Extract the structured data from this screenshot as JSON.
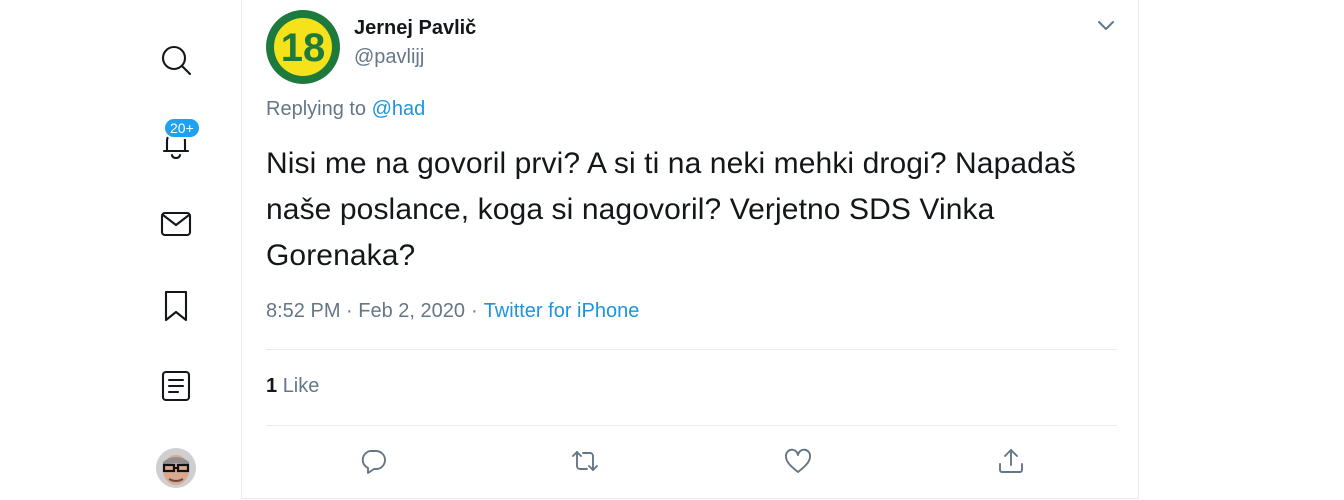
{
  "sidebar": {
    "notification_badge": "20+",
    "icons": [
      "search-icon",
      "bell-icon",
      "mail-icon",
      "bookmark-icon",
      "lists-icon",
      "profile-avatar"
    ]
  },
  "tweet": {
    "author": {
      "name": "Jernej Pavlič",
      "handle": "@pavlijj",
      "avatar_text": "18",
      "avatar_colors": {
        "background": "#1e7a3c",
        "circle": "#f5e21a",
        "text": "#1e7a3c"
      }
    },
    "replying_prefix": "Replying to",
    "replying_to": "@had",
    "text": "Nisi me na govoril prvi? A si ti na neki mehki drogi? Napadaš naše poslance, koga si nagovoril? Verjetno SDS Vinka Gorenaka?",
    "time": "8:52 PM · Feb 2, 2020",
    "separator": "·",
    "source": "Twitter for iPhone",
    "likes": {
      "count": "1",
      "label": "Like"
    }
  },
  "colors": {
    "accent": "#1da1f2",
    "link": "#1b95e0",
    "muted": "#657786",
    "text": "#14171a",
    "divider": "#e6ecf0"
  }
}
